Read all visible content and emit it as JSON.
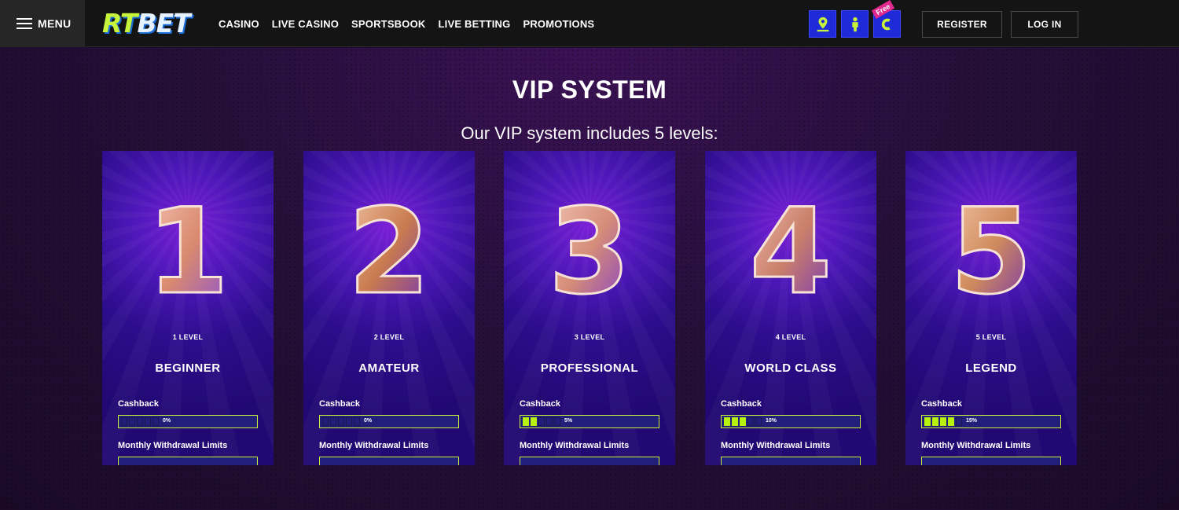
{
  "header": {
    "menu_label": "MENU",
    "logo_rt": "RT",
    "logo_bet": "BET",
    "nav": [
      "CASINO",
      "LIVE CASINO",
      "SPORTSBOOK",
      "LIVE BETTING",
      "PROMOTIONS"
    ],
    "free_tag": "Free",
    "register_label": "REGISTER",
    "login_label": "LOG IN"
  },
  "main": {
    "title": "VIP SYSTEM",
    "subtitle": "Our VIP system includes 5 levels:"
  },
  "levels": [
    {
      "number": "1",
      "level_label": "1 LEVEL",
      "name": "BEGINNER",
      "cashback_label": "Cashback",
      "cashback_value": "0%",
      "cashback_fraction": 0.0,
      "withdraw_label": "Monthly Withdrawal Limits"
    },
    {
      "number": "2",
      "level_label": "2 LEVEL",
      "name": "AMATEUR",
      "cashback_label": "Cashback",
      "cashback_value": "0%",
      "cashback_fraction": 0.0,
      "withdraw_label": "Monthly Withdrawal Limits"
    },
    {
      "number": "3",
      "level_label": "3 LEVEL",
      "name": "PROFESSIONAL",
      "cashback_label": "Cashback",
      "cashback_value": "5%",
      "cashback_fraction": 0.4,
      "withdraw_label": "Monthly Withdrawal Limits"
    },
    {
      "number": "4",
      "level_label": "4 LEVEL",
      "name": "WORLD CLASS",
      "cashback_label": "Cashback",
      "cashback_value": "10%",
      "cashback_fraction": 0.6,
      "withdraw_label": "Monthly Withdrawal Limits"
    },
    {
      "number": "5",
      "level_label": "5 LEVEL",
      "name": "LEGEND",
      "cashback_label": "Cashback",
      "cashback_value": "15%",
      "cashback_fraction": 0.8,
      "withdraw_label": "Monthly Withdrawal Limits"
    }
  ],
  "icons": {
    "menu": "hamburger-icon",
    "location": "map-pin-icon",
    "support": "person-icon",
    "coin": "coin-icon"
  },
  "colors": {
    "accent": "#c7f43a",
    "header_bg": "#141414",
    "icon_bg": "#1f2bd9",
    "card_bg": "#2c0d8c"
  }
}
